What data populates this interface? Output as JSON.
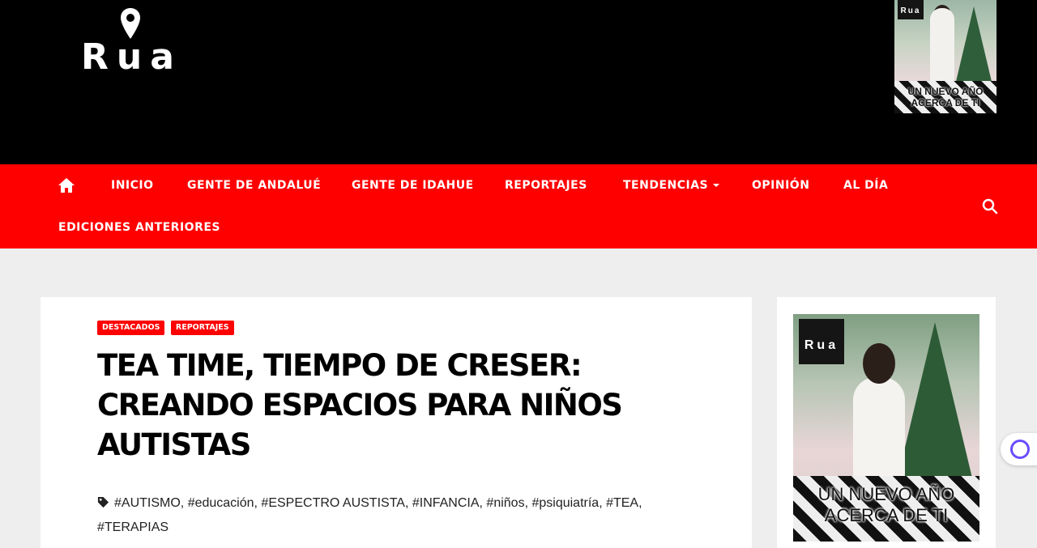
{
  "header": {
    "logo_text": "Rua",
    "ad": {
      "logo_text": "Rua",
      "line1": "UN NUEVO AÑO",
      "line2": "ACERCA DE TI"
    }
  },
  "nav": {
    "items": [
      {
        "label": "INICIO"
      },
      {
        "label": "GENTE DE ANDALUÉ"
      },
      {
        "label": "GENTE DE IDAHUE"
      },
      {
        "label": "REPORTAJES"
      },
      {
        "label": "TENDENCIAS"
      },
      {
        "label": "OPINIÓN"
      },
      {
        "label": "AL DÍA"
      },
      {
        "label": "EDICIONES ANTERIORES"
      }
    ]
  },
  "post": {
    "categories": [
      "DESTACADOS",
      "REPORTAJES"
    ],
    "title": "TEA TIME, TIEMPO DE CRESER: CREANDO ESPACIOS PARA NIÑOS AUTISTAS",
    "tags": [
      "#AUTISMO",
      "#educación",
      "#ESPECTRO AUSTISTA",
      "#INFANCIA",
      "#niños",
      "#psiquiatría",
      "#TEA",
      "#TERAPIAS"
    ]
  },
  "sidebar": {
    "ad": {
      "logo_text": "Rua",
      "line1": "UN NUEVO AÑO",
      "line2": "ACERCA DE TI"
    }
  },
  "colors": {
    "nav_background": "#ff0000",
    "header_background": "#000000",
    "page_background": "#eeeeee",
    "badge_background": "#ff0000"
  }
}
